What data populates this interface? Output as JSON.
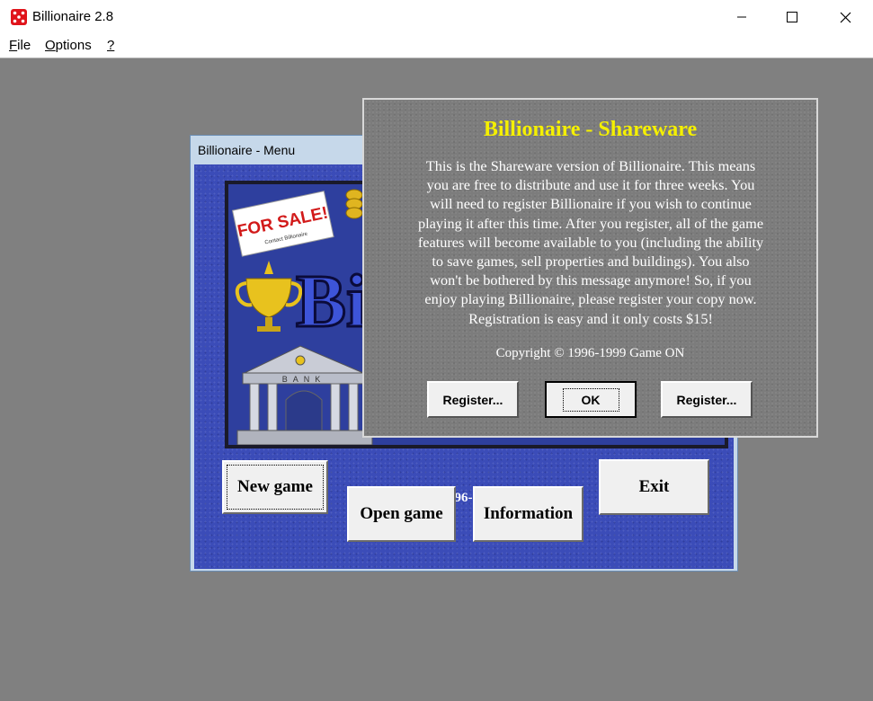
{
  "window": {
    "title": "Billionaire 2.8",
    "icon": "red-dice-icon"
  },
  "menubar": {
    "items": [
      {
        "label": "File",
        "mnemonic": "F",
        "rest": "ile"
      },
      {
        "label": "Options",
        "mnemonic": "O",
        "rest": "ptions"
      },
      {
        "label": "?",
        "mnemonic": "?",
        "rest": ""
      }
    ]
  },
  "menu_window": {
    "title": "Billionaire - Menu",
    "art": {
      "for_sale_sign": "FOR SALE!",
      "for_sale_small": "Contact Billionaire",
      "logo_text": "Bi",
      "bank_sign": "BANK"
    },
    "buttons": {
      "new_game": "New game",
      "open_game": "Open game",
      "information": "Information",
      "exit": "Exit"
    },
    "copyright": "Copyright © 1996-1999 Game ON"
  },
  "dialog": {
    "title": "Billionaire - Shareware",
    "body_lines": [
      "This is the Shareware version of Billionaire. This means",
      "you are free to distribute and use it for three weeks. You",
      "will need to register Billionaire if you wish to continue",
      "playing it after this time. After you register, all of the game",
      "features will become available to you (including the ability",
      "to save games, sell properties and buildings). You also",
      "won't be bothered by this message anymore! So, if you",
      "enjoy playing Billionaire, please register your copy now.",
      "Registration is easy and it only costs $15!"
    ],
    "copyright": "Copyright © 1996-1999 Game ON",
    "buttons": {
      "register_left": "Register...",
      "ok": "OK",
      "register_right": "Register..."
    }
  },
  "colors": {
    "dialog_title": "#f5f000",
    "client_bg": "#808080",
    "menu_bg": "#3b4cb8"
  }
}
